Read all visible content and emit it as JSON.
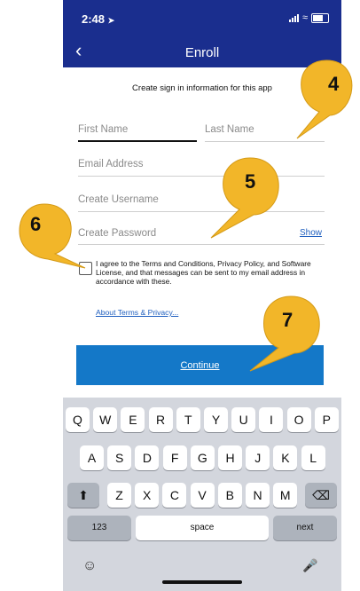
{
  "status": {
    "time": "2:48",
    "location_icon": "location-arrow-icon"
  },
  "nav": {
    "title": "Enroll",
    "back_icon": "chevron-left-icon"
  },
  "form": {
    "subtitle": "Create sign in information for this app",
    "first_name_placeholder": "First Name",
    "last_name_placeholder": "Last Name",
    "email_placeholder": "Email Address",
    "username_placeholder": "Create Username",
    "password_placeholder": "Create Password",
    "show_label": "Show",
    "terms_text": "I agree to the Terms and Conditions, Privacy Policy, and Software License, and that messages can be sent to my email address in accordance with these.",
    "terms_checked": false,
    "about_link": "About Terms & Privacy...",
    "continue_label": "Continue"
  },
  "callouts": [
    "4",
    "5",
    "6",
    "7"
  ],
  "keyboard": {
    "row1": [
      "Q",
      "W",
      "E",
      "R",
      "T",
      "Y",
      "U",
      "I",
      "O",
      "P"
    ],
    "row2": [
      "A",
      "S",
      "D",
      "F",
      "G",
      "H",
      "J",
      "K",
      "L"
    ],
    "row3": [
      "Z",
      "X",
      "C",
      "V",
      "B",
      "N",
      "M"
    ],
    "numbers_label": "123",
    "space_label": "space",
    "next_label": "next",
    "shift_icon": "shift-arrow-icon",
    "delete_icon": "delete-backspace-icon",
    "emoji_icon": "emoji-face-icon",
    "mic_icon": "microphone-icon"
  },
  "colors": {
    "header": "#1a2e8e",
    "button": "#1478c8",
    "link": "#1f5fbf",
    "callout": "#f2b629"
  }
}
